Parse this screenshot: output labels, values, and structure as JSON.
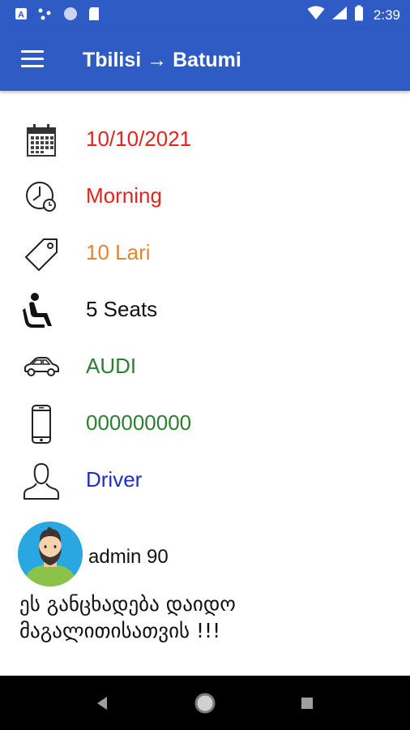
{
  "status_bar": {
    "time": "2:39",
    "left_icons": [
      "text-a-icon",
      "dots-icon",
      "circle-icon",
      "sd-card-icon"
    ],
    "right_icons": [
      "wifi-icon",
      "signal-icon",
      "battery-icon"
    ]
  },
  "app_bar": {
    "title": "Tbilisi → Batumi",
    "menu_icon": "hamburger-menu-icon",
    "color": "#2f5bc4"
  },
  "details": [
    {
      "icon": "calendar-icon",
      "value": "10/10/2021",
      "color": "#e0261d"
    },
    {
      "icon": "clock-icon",
      "value": "Morning",
      "color": "#e0261d"
    },
    {
      "icon": "price-tag-icon",
      "value": "10 Lari",
      "color": "#e8842a"
    },
    {
      "icon": "seat-icon",
      "value": "5 Seats",
      "color": "#111111"
    },
    {
      "icon": "car-icon",
      "value": "AUDI",
      "color": "#2e7d32"
    },
    {
      "icon": "phone-icon",
      "value": "000000000",
      "color": "#2e7d32"
    },
    {
      "icon": "user-icon",
      "value": "Driver",
      "color": "#1f2ecb"
    }
  ],
  "poster": {
    "name": "admin 90",
    "avatar_icon": "bearded-man-avatar"
  },
  "message": "ეს განცხადება დაიდო მაგალითისათვის !!!",
  "nav_bar": {
    "buttons": [
      "back-icon",
      "home-icon",
      "recents-icon"
    ]
  }
}
